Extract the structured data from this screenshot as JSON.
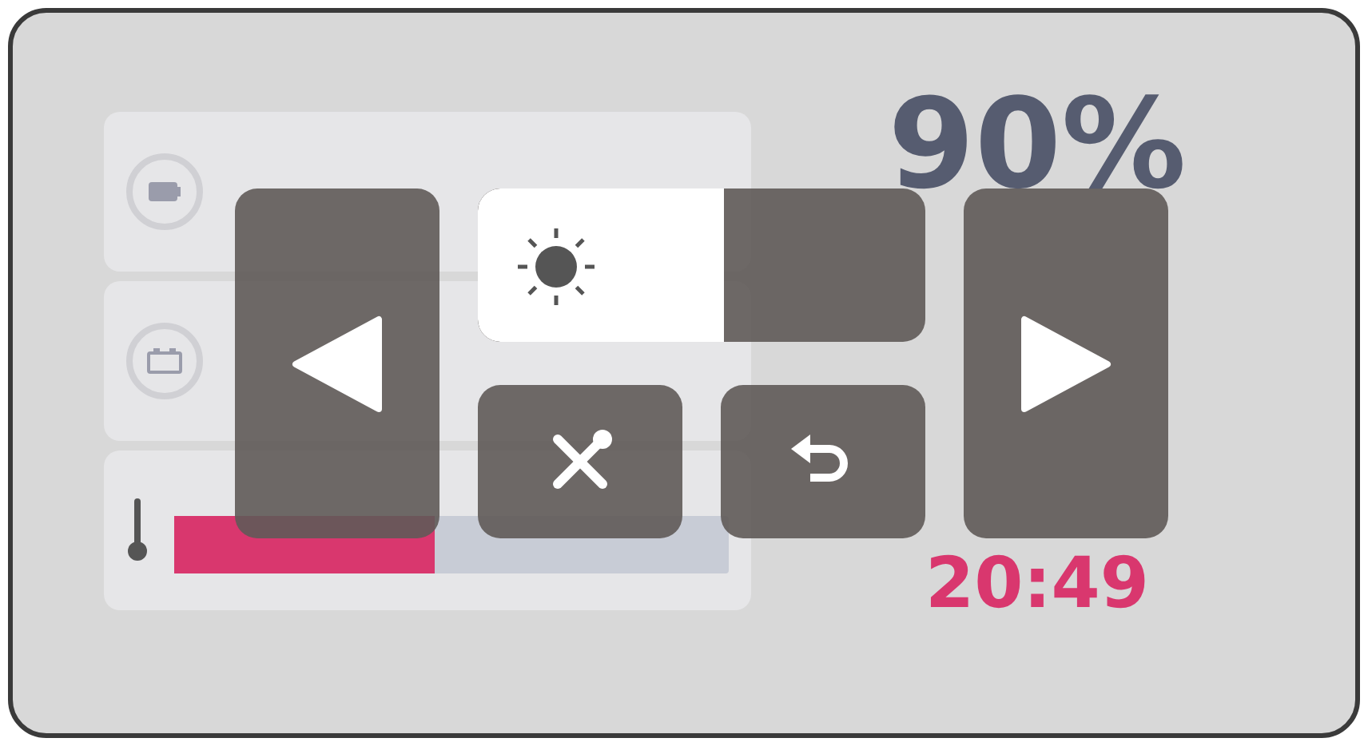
{
  "dashboard": {
    "temperature_bar": {
      "level": 0.47
    },
    "soc_value": "90%",
    "time": "20:49"
  },
  "overlay": {
    "brightness": {
      "level": 0.55
    }
  }
}
